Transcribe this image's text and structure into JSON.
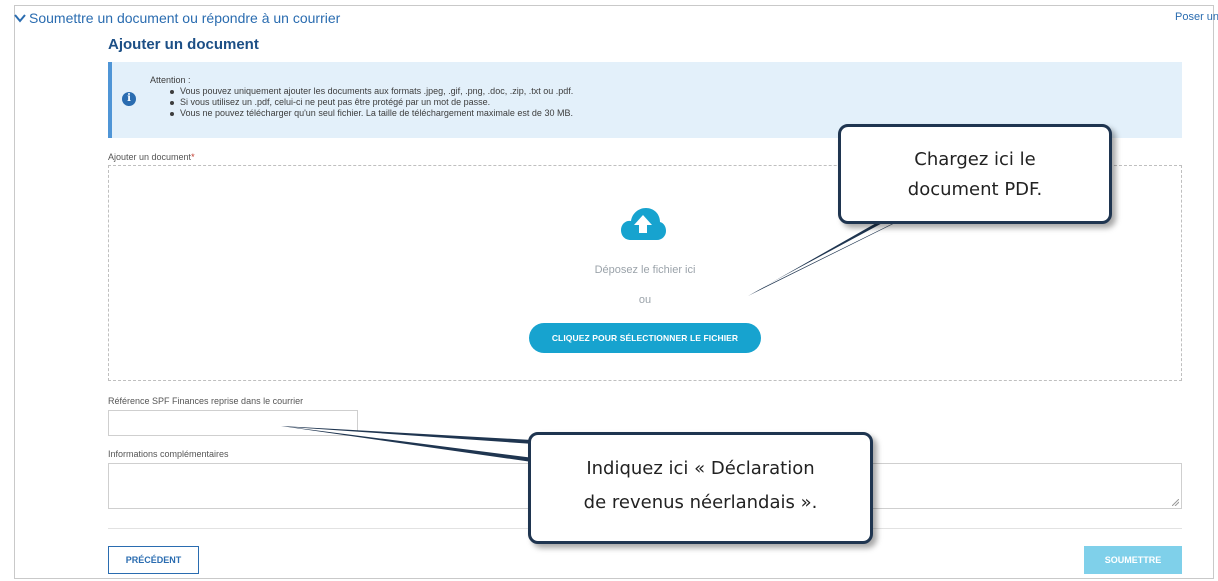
{
  "section": {
    "title": "Soumettre un document ou répondre à un courrier",
    "right_link": "Poser un"
  },
  "page": {
    "title": "Ajouter un document"
  },
  "alert": {
    "heading": "Attention :",
    "items": [
      "Vous pouvez uniquement ajouter les documents aux formats .jpeg, .gif, .png, .doc, .zip, .txt ou .pdf.",
      "Si vous utilisez un .pdf, celui-ci ne peut pas être protégé par un mot de passe.",
      "Vous ne pouvez télécharger qu'un seul fichier. La taille de téléchargement maximale est de 30 MB."
    ]
  },
  "upload": {
    "label": "Ajouter un document",
    "required_mark": "*",
    "drop_text": "Déposez le fichier ici",
    "or_text": "ou",
    "select_button": "CLIQUEZ POUR SÉLECTIONNER LE FICHIER"
  },
  "reference": {
    "label": "Référence SPF Finances reprise dans le courrier",
    "value": ""
  },
  "extra_info": {
    "label": "Informations complémentaires",
    "value": ""
  },
  "buttons": {
    "previous": "PRÉCÉDENT",
    "submit": "SOUMETTRE"
  },
  "callouts": {
    "upload_line1": "Chargez ici le",
    "upload_line2": "document PDF.",
    "ref_line1": "Indiquez ici « Déclaration",
    "ref_line2": "de revenus néerlandais »."
  },
  "colors": {
    "link_blue": "#2a6cb0",
    "accent_cyan": "#17a3cf",
    "submit_disabled": "#7fd0ea",
    "callout_border": "#1f3550",
    "alert_bg": "#e3f0fa"
  }
}
